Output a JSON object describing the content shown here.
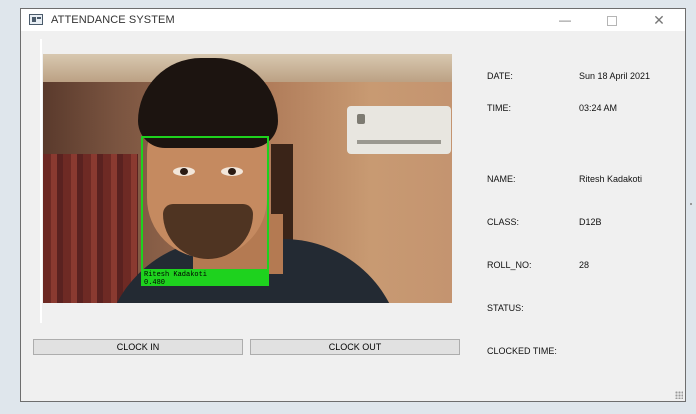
{
  "window": {
    "title": "ATTENDANCE SYSTEM",
    "controls": {
      "minimize": "—",
      "close": "✕"
    }
  },
  "camera": {
    "detection_label_line1": "Ritesh Kadakoti",
    "detection_label_line2": "0.480",
    "box_color": "#1ed21e"
  },
  "buttons": {
    "clock_in": "CLOCK IN",
    "clock_out": "CLOCK OUT"
  },
  "info": {
    "date_label": "DATE:",
    "date_value": "Sun 18 April 2021",
    "time_label": "TIME:",
    "time_value": "03:24 AM",
    "name_label": "NAME:",
    "name_value": "Ritesh Kadakoti",
    "class_label": "CLASS:",
    "class_value": "D12B",
    "roll_label": "ROLL_NO:",
    "roll_value": "28",
    "status_label": "STATUS:",
    "clocked_time_label": "CLOCKED TIME:"
  }
}
